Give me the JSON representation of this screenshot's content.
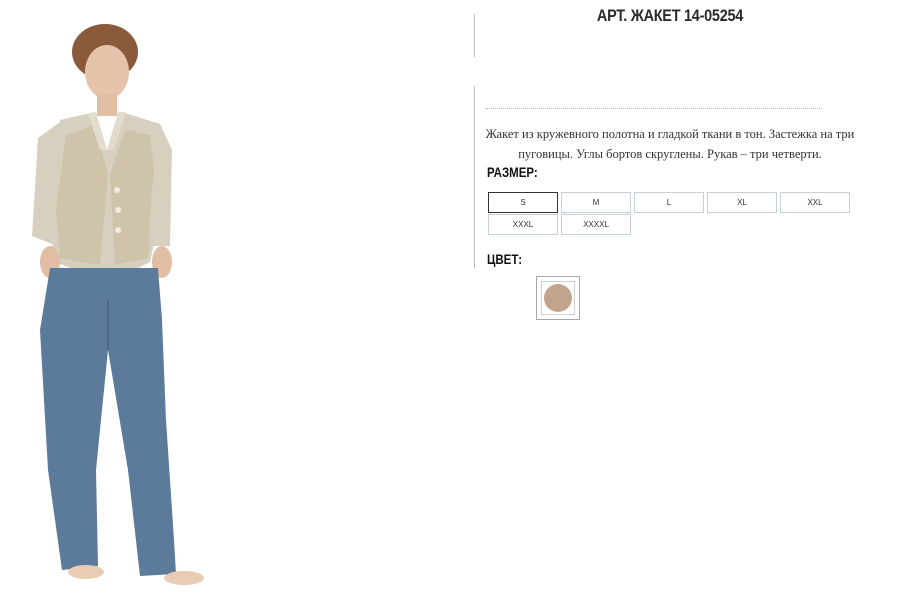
{
  "product": {
    "title": "АРТ. ЖАКЕТ 14-05254",
    "description": "Жакет из кружевного полотна и гладкой ткани в тон. Застежка на три пуговицы. Углы бортов скруглены. Рукав – три четверти."
  },
  "size_section": {
    "label": "РАЗМЕР:",
    "selected": "S",
    "options": [
      "S",
      "M",
      "L",
      "XL",
      "XXL",
      "XXXL",
      "XXXXL"
    ]
  },
  "color_section": {
    "label": "ЦВЕТ:",
    "swatch_color": "#c2a48c"
  },
  "photo": {
    "icon": "model-photo"
  }
}
